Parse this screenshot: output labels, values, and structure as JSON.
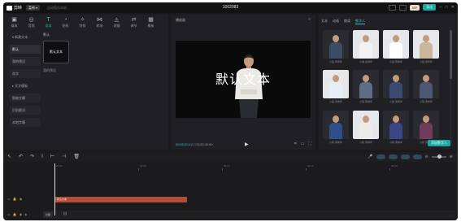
{
  "titlebar": {
    "app_name": "剪映",
    "menu_label": "菜单",
    "autosave": "自动保存本地 ...",
    "document_title": "1002083",
    "vip_label": "VIP",
    "export_label": "导出"
  },
  "resource_tabs": [
    {
      "label": "媒体",
      "icon": "media-icon"
    },
    {
      "label": "音频",
      "icon": "audio-icon"
    },
    {
      "label": "文本",
      "icon": "text-icon"
    },
    {
      "label": "贴纸",
      "icon": "sticker-icon"
    },
    {
      "label": "特效",
      "icon": "effect-icon"
    },
    {
      "label": "转场",
      "icon": "transition-icon"
    },
    {
      "label": "滤镜",
      "icon": "filter-icon"
    },
    {
      "label": "调节",
      "icon": "adjust-icon"
    },
    {
      "label": "模板",
      "icon": "template-icon"
    }
  ],
  "sidebar": {
    "items": [
      {
        "label": "▾ 新建文本"
      },
      {
        "label": "默认"
      },
      {
        "label": "我的预设"
      },
      {
        "label": "花字"
      },
      {
        "label": "▸ 文字模板"
      },
      {
        "label": "智能字幕"
      },
      {
        "label": "识别歌词"
      },
      {
        "label": "本地字幕"
      }
    ]
  },
  "resource_content": {
    "section_title": "默认",
    "card_label": "默认文本",
    "preset_title": "我的预设"
  },
  "player": {
    "title": "播放器",
    "overlay_text": "默认文本",
    "current_time": "00:00:00:12",
    "total_time": "00:00:40:00"
  },
  "digital_human": {
    "tabs": [
      "文本",
      "动画",
      "朗读",
      "数字人"
    ],
    "active_tab": "数字人",
    "button_label": "添加数字人",
    "avatars": [
      {
        "name": "小铭·男青年",
        "body": "#3b4c63",
        "bg": "dark"
      },
      {
        "name": "小琪·女青年",
        "body": "#f2f2f2",
        "bg": "light"
      },
      {
        "name": "小铭·男青年",
        "body": "#ffffff",
        "bg": "light"
      },
      {
        "name": "小铭·男青年",
        "body": "#c9b79a",
        "bg": "light"
      },
      {
        "name": "小铭·男青年",
        "body": "#e8eef5",
        "bg": "light"
      },
      {
        "name": "小锐·男青年",
        "body": "#5d6d84",
        "bg": "dark"
      },
      {
        "name": "小锐·男青年",
        "body": "#3a4a70",
        "bg": "dark"
      },
      {
        "name": "小锐·男青年",
        "body": "#4b5773",
        "bg": "dark"
      },
      {
        "name": "小新·男青年",
        "body": "#2f4e8a",
        "bg": "dark"
      },
      {
        "name": "小新·男青年",
        "body": "#ecebea",
        "bg": "light"
      },
      {
        "name": "小新·男青年",
        "body": "#3b4686",
        "bg": "dark"
      },
      {
        "name": "小新·男青年",
        "body": "#6f3d5b",
        "bg": "dark"
      }
    ]
  },
  "timeline": {
    "ruler_labels": [
      "00:00",
      "00:05",
      "00:10",
      "00:15",
      "00:20",
      "00:25"
    ],
    "text_clip_label": "默认文本",
    "cover_label": "封面"
  },
  "colors": {
    "accent": "#36c4c8",
    "export": "#19a7a0",
    "clip": "#b24d3c"
  }
}
